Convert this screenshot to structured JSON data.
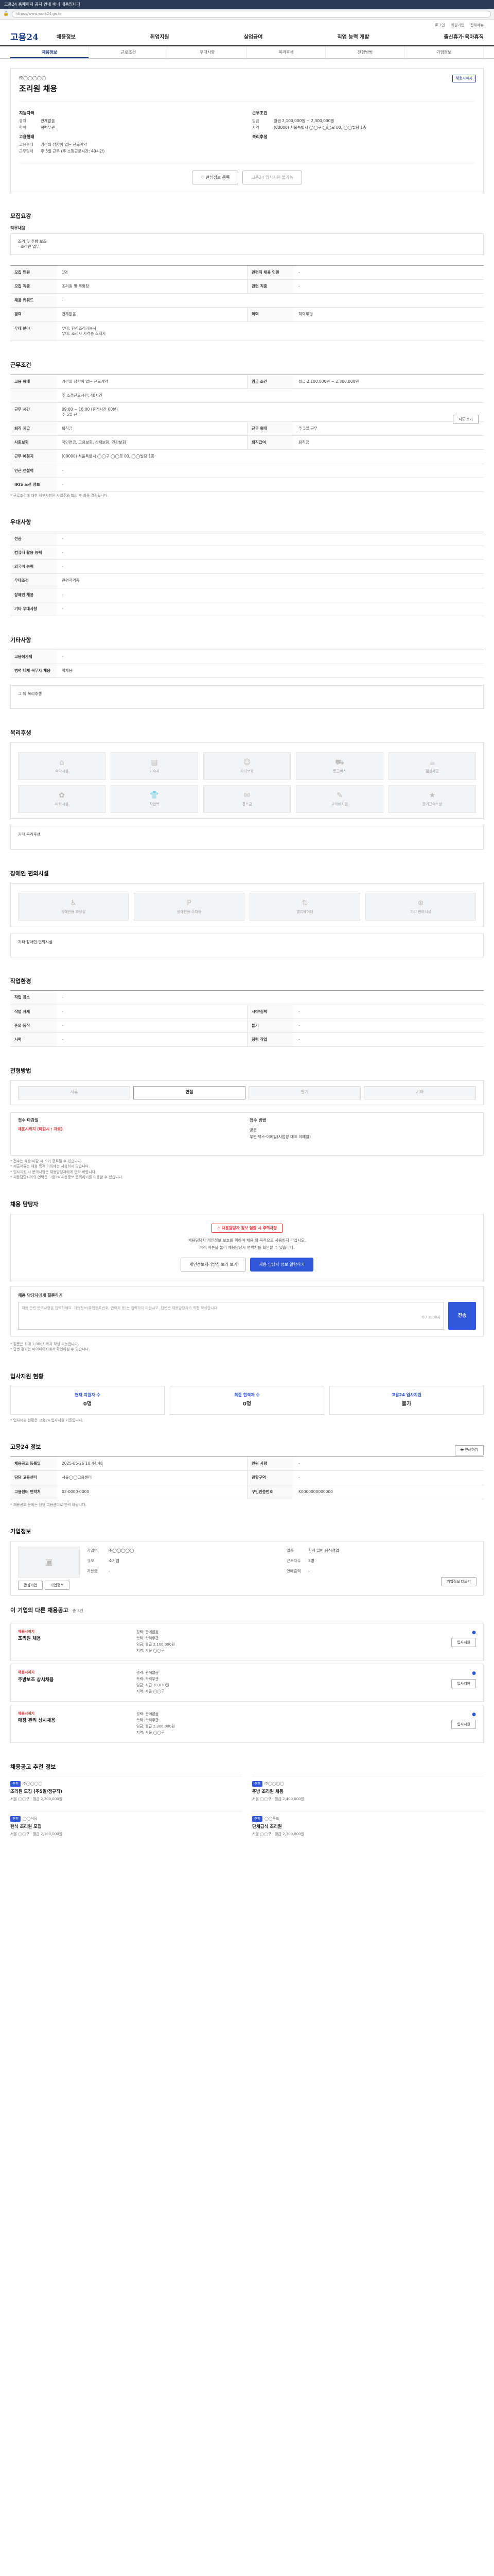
{
  "notice_bar": "고용24 홈페이지 공지 안내 배너 내용입니다",
  "url": "https://www.work24.go.kr",
  "util": [
    "로그인",
    "회원가입",
    "전체메뉴"
  ],
  "logo": "고용24",
  "menu": [
    "채용정보",
    "취업지원",
    "실업급여",
    "직업 능력 개발",
    "출산휴가·육아휴직"
  ],
  "tabs": [
    "채용정보",
    "근로조건",
    "우대사항",
    "복리후생",
    "전형방법",
    "기업정보"
  ],
  "hero": {
    "badge": "채용시까지",
    "company": "㈜◯◯◯◯◯",
    "title": "조리원 채용",
    "col1_title": "지원자격",
    "rows1": [
      {
        "k": "경력",
        "v": "관계없음"
      },
      {
        "k": "학력",
        "v": "학력무관"
      }
    ],
    "col1b_title": "고용형태",
    "rows1b": [
      {
        "k": "고용형태",
        "v": "기간의 정함이 없는 근로계약"
      },
      {
        "k": "근무형태",
        "v": "주 5일 근무 (주 소정근로시간: 40시간)"
      }
    ],
    "col2_title": "근무조건",
    "rows2": [
      {
        "k": "임금",
        "v": "월급 2,100,000원 ~ 2,300,000원"
      },
      {
        "k": "지역",
        "v": "(00000) 서울특별시 ◯◯구 ◯◯로 00, ◯◯빌딩 1층"
      }
    ],
    "col2b_title": "복리후생",
    "btn_save": "관심정보 등록",
    "btn_apply": "고용24 입사지원 불가능"
  },
  "s1": {
    "title": "모집요강",
    "sub_title": "직무내용",
    "sub_body": "조리 및 주방 보조\n· 조리원 업무",
    "rows": [
      {
        "th": "모집 인원",
        "td": "1명",
        "th2": "관련직 채용 인원",
        "td2": "-"
      },
      {
        "th": "모집 직종",
        "td": "조리원 및 주방장",
        "th2": "관련 직종",
        "td2": "-"
      },
      {
        "th": "채용 키워드",
        "td": "-",
        "th2": "",
        "td2": ""
      },
      {
        "th": "경력",
        "td": "관계없음",
        "th2": "학력",
        "td2": "학력무관"
      },
      {
        "th": "우대 분야",
        "td": "우대: 한식조리기능사\n우대: 조리사 자격증 소지자",
        "th2": "",
        "td2": ""
      }
    ]
  },
  "s2": {
    "title": "근무조건",
    "rows": [
      {
        "th": "고용 형태",
        "td": "기간의 정함이 없는 근로계약",
        "th2": "임금 조건",
        "td2": "월급 2,100,000원 ~ 2,300,000원"
      },
      {
        "th": "",
        "td": "주 소정근로시간: 40시간",
        "th2": "",
        "td2": ""
      },
      {
        "th": "근무 시간",
        "td": "09:00 ~ 18:00 (휴게시간 60분)\n주 5일 근무",
        "th2": "",
        "td2": ""
      },
      {
        "th": "퇴직 지급",
        "td": "퇴직금",
        "th2": "근무 형태",
        "td2": "주 5일 근무"
      },
      {
        "th": "사회보험",
        "td": "국민연금, 고용보험, 산재보험, 건강보험",
        "th2": "퇴직급여",
        "td2": "퇴직금"
      },
      {
        "th": "근무 예정지",
        "td": "(00000) 서울특별시 ◯◯구 ◯◯로 00, ◯◯빌딩 1층",
        "th2": "",
        "td2": ""
      },
      {
        "th": "인근 전철역",
        "td": "-",
        "th2": "",
        "td2": ""
      },
      {
        "th": "IRIS 노선 정보",
        "td": "-",
        "th2": "",
        "td2": ""
      }
    ],
    "btn_map": "지도 보기",
    "note": "* 근로조건에 대한 세부사항은 사업주와 협의 후 최종 결정됩니다."
  },
  "s3": {
    "title": "우대사항",
    "rows": [
      {
        "th": "전공",
        "td": "-"
      },
      {
        "th": "컴퓨터 활용 능력",
        "td": "-"
      },
      {
        "th": "외국어 능력",
        "td": "-"
      },
      {
        "th": "우대조건",
        "td": "관련자격증"
      },
      {
        "th": "장애인 채용",
        "td": "-"
      },
      {
        "th": "기타 우대사항",
        "td": "-"
      }
    ]
  },
  "s4": {
    "title": "기타사항",
    "rows": [
      {
        "th": "고용허가제",
        "td": "-"
      },
      {
        "th": "병역 대체 복무자 채용",
        "td": "미채용"
      }
    ],
    "sub_title": "그 외 복리후생"
  },
  "s5": {
    "title": "복리후생",
    "items": [
      "숙박시설",
      "기숙사",
      "자녀보육",
      "통근버스",
      "점심제공",
      "미화시설",
      "작업복",
      "경조금",
      "교육비지원",
      "장기근속포상"
    ],
    "sub": "기타 복리후생"
  },
  "s6": {
    "title": "장애인 편의시설",
    "items": [
      "장애인용 화장실",
      "장애인용 주차장",
      "엘리베이터",
      "기타 편의시설"
    ],
    "sub": "기타 장애인 편의시설"
  },
  "s7": {
    "title": "작업환경",
    "rows": [
      {
        "th": "작업 장소",
        "td": "-",
        "th2": "",
        "td2": ""
      },
      {
        "th": "작업 자세",
        "td": "-",
        "th2": "시야/청력",
        "td2": "-"
      },
      {
        "th": "손의 동작",
        "td": "-",
        "th2": "들기",
        "td2": "-"
      },
      {
        "th": "시력",
        "td": "-",
        "th2": "청력 작업",
        "td2": "-"
      }
    ]
  },
  "s8": {
    "title": "전형방법",
    "opts": [
      "서류",
      "면접",
      "필기",
      "기타"
    ],
    "col1_label": "접수 마감일",
    "col1_val": "채용시까지 (마감시 : 자료)",
    "col2_label": "접수 방법",
    "col2_val": "방문\n우편·팩스·이메일(사업장 대표 이메일)",
    "notes": [
      "* 접수는 채용 마감 시 조기 종료될 수 있습니다.",
      "* 제출서류는 채용 목적 이외에는 사용하지 않습니다.",
      "* 입사지원 시 문의사항은 채용담당자에게 연락 바랍니다.",
      "* 채용담당자와의 연락은 고용24 채용정보 문의하기를 이용할 수 있습니다."
    ]
  },
  "s9": {
    "title": "채용 담당자",
    "warn": "채용담당자 정보 열람 시 주의사항",
    "body": "채용담당자 개인정보 보호를 위하여 채용 외 목적으로 사용하지 마십시오.",
    "body2": "아래 버튼을 눌러 채용담당자 연락처를 확인할 수 있습니다.",
    "btn1": "개인정보처리방침 보러 보기",
    "btn2": "채용 담당자 정보 열람하기"
  },
  "s10": {
    "title": "채용 담당자에게 질문하기",
    "placeholder": "채용 관련 문의사항을 입력하세요. 개인정보(주민등록번호, 연락처 등)는 입력하지 마십시오. 답변은 채용담당자가 직접 작성합니다.",
    "count": "0 / 1000자",
    "send": "전송",
    "notes": [
      "* 질문은 최대 1,000자까지 작성 가능합니다.",
      "* 답변 결과는 마이페이지에서 확인하실 수 있습니다."
    ]
  },
  "s11": {
    "title": "입사지원 현황",
    "cards": [
      {
        "t": "현재 지원자 수",
        "v": "0명"
      },
      {
        "t": "최종 합격자 수",
        "v": "0명"
      },
      {
        "t": "고용24 입사지원",
        "v": "불가"
      }
    ],
    "note": "* 입사지원 현황은 고용24 입사지원 기준입니다."
  },
  "s12": {
    "title": "고용24 정보",
    "btn_print": "인쇄하기",
    "rows": [
      {
        "th": "채용공고 등록일",
        "td": "2025-05-26 10:44:48",
        "th2": "민원 사항",
        "td2": "-"
      },
      {
        "th": "담당 고용센터",
        "td": "서울◯◯고용센터",
        "th2": "관할구역",
        "td2": "-"
      },
      {
        "th": "고용센터 연락처",
        "td": "02-0000-0000",
        "th2": "구인인증번호",
        "td2": "K0000000000000"
      }
    ],
    "note": "* 채용공고 문의는 담당 고용센터로 연락 바랍니다."
  },
  "s13": {
    "title": "기업정보",
    "btn1": "관심기업",
    "btn2": "기업정보",
    "rows": [
      {
        "k": "기업명",
        "v": "㈜◯◯◯◯◯"
      },
      {
        "k": "업종",
        "v": "한식 일반 음식점업"
      },
      {
        "k": "규모",
        "v": "소기업"
      },
      {
        "k": "근로자수",
        "v": "5명"
      },
      {
        "k": "자본금",
        "v": "-"
      },
      {
        "k": "연매출액",
        "v": "-"
      }
    ],
    "btn_more": "기업정보 더보기"
  },
  "s14": {
    "title": "이 기업의 다른 채용공고",
    "count": "총 3건",
    "items": [
      {
        "tag": "채용시까지",
        "title": "조리원 채용",
        "d": [
          "경력: 관계없음",
          "학력: 학력무관",
          "임금: 월급 2,100,000원",
          "지역: 서울 ◯◯구"
        ],
        "btn": "입사지원"
      },
      {
        "tag": "채용시까지",
        "title": "주방보조 상시채용",
        "d": [
          "경력: 관계없음",
          "학력: 학력무관",
          "임금: 시급 10,030원",
          "지역: 서울 ◯◯구"
        ],
        "btn": "입사지원"
      },
      {
        "tag": "채용시까지",
        "title": "매장 관리 상시채용",
        "d": [
          "경력: 관계없음",
          "학력: 학력무관",
          "임금: 월급 2,300,000원",
          "지역: 서울 ◯◯구"
        ],
        "btn": "입사지원"
      }
    ]
  },
  "s15": {
    "title": "채용공고 추천 정보",
    "items": [
      {
        "tag": "추천",
        "co": "㈜◯◯◯◯",
        "t": "조리원 모집 (주5일/정규직)",
        "m": "서울 ◯◯구 · 월급 2,200,000원"
      },
      {
        "tag": "추천",
        "co": "㈜◯◯◯◯",
        "t": "주방 조리원 채용",
        "m": "서울 ◯◯구 · 월급 2,400,000원"
      },
      {
        "tag": "추천",
        "co": "◯◯식당",
        "t": "한식 조리원 모집",
        "m": "서울 ◯◯구 · 월급 2,100,000원"
      },
      {
        "tag": "추천",
        "co": "◯◯푸드",
        "t": "단체급식 조리원",
        "m": "서울 ◯◯구 · 월급 2,300,000원"
      }
    ]
  }
}
